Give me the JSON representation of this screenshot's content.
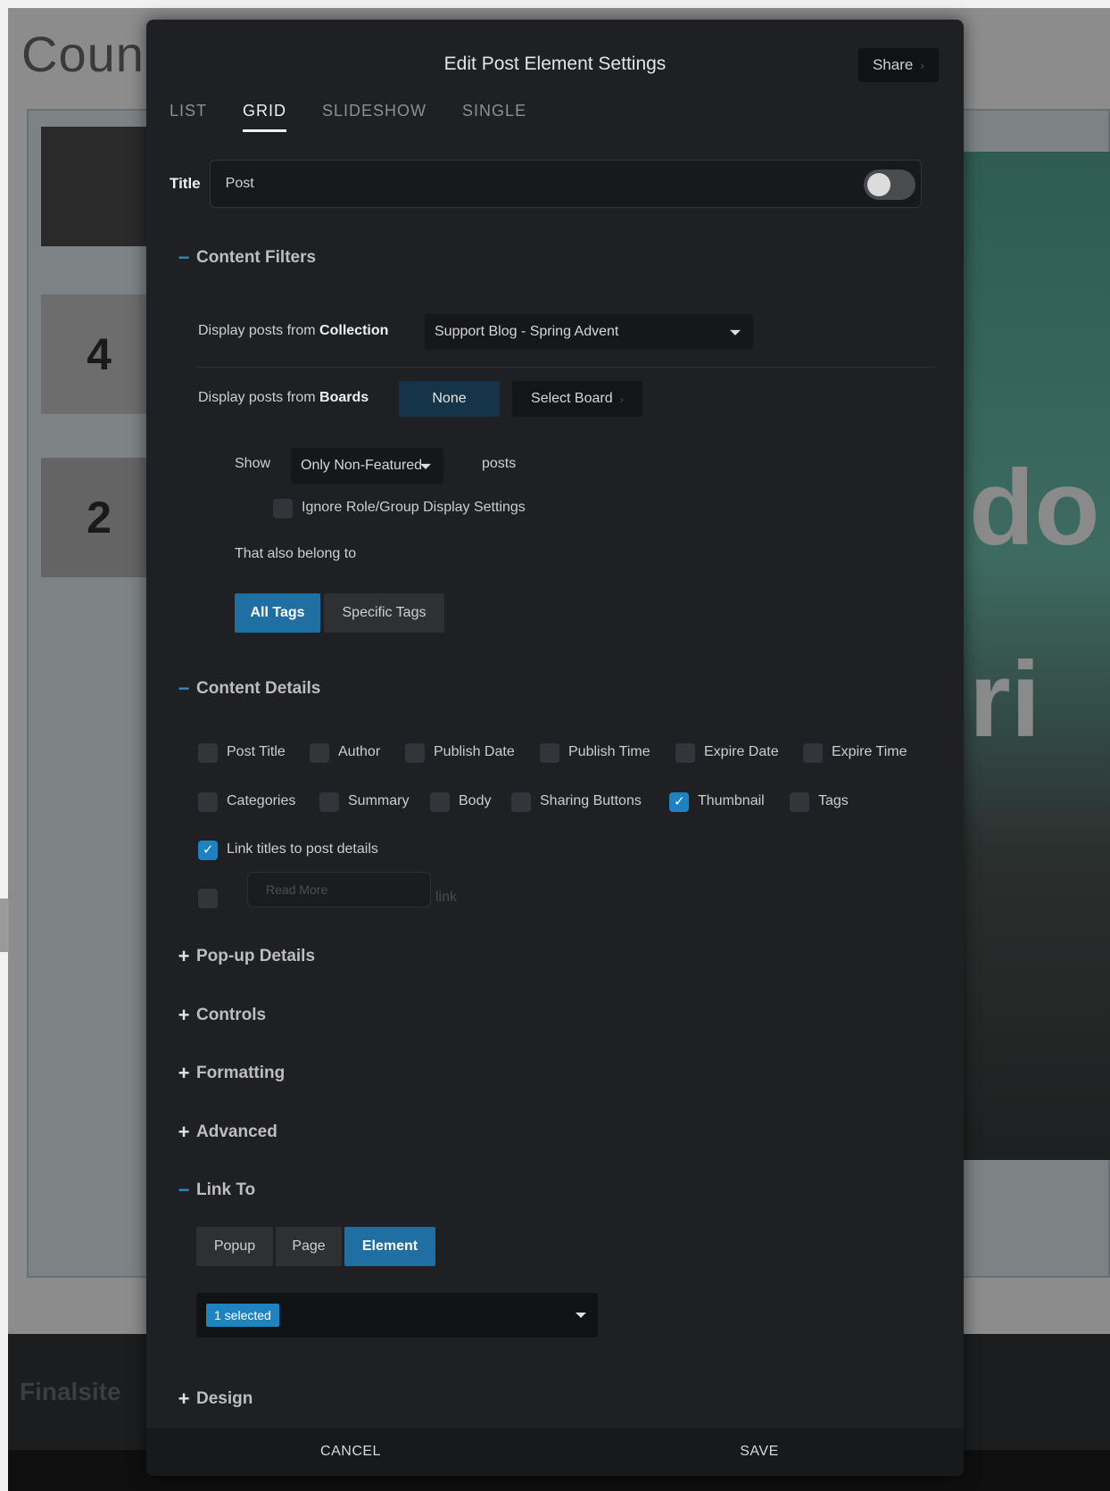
{
  "background": {
    "heading": "Coun",
    "thumb_numbers": [
      "",
      "4",
      "2"
    ],
    "hero_text": [
      "do",
      "ri"
    ],
    "footer_logo": "Finalsite"
  },
  "modal": {
    "title": "Edit Post Element Settings",
    "share_label": "Share",
    "tabs": [
      {
        "label": "LIST",
        "active": false
      },
      {
        "label": "GRID",
        "active": true
      },
      {
        "label": "SLIDESHOW",
        "active": false
      },
      {
        "label": "SINGLE",
        "active": false
      }
    ],
    "title_field": {
      "label": "Title",
      "value": "Post",
      "toggle_on": false
    },
    "content_filters": {
      "heading": "Content Filters",
      "collection_label_prefix": "Display posts from ",
      "collection_label_bold": "Collection",
      "collection_value": "Support Blog - Spring Advent",
      "boards_label_prefix": "Display posts from ",
      "boards_label_bold": "Boards",
      "boards_value": "None",
      "select_board_label": "Select Board",
      "show_label": "Show",
      "show_value": "Only Non-Featured",
      "posts_label": "posts",
      "ignore_role_label": "Ignore Role/Group Display Settings",
      "also_belong_label": "That also belong to",
      "tag_buttons": [
        {
          "label": "All Tags",
          "active": true
        },
        {
          "label": "Specific Tags",
          "active": false
        }
      ]
    },
    "content_details": {
      "heading": "Content Details",
      "row1": [
        {
          "label": "Post Title",
          "checked": false
        },
        {
          "label": "Author",
          "checked": false
        },
        {
          "label": "Publish Date",
          "checked": false
        },
        {
          "label": "Publish Time",
          "checked": false
        },
        {
          "label": "Expire Date",
          "checked": false
        },
        {
          "label": "Expire Time",
          "checked": false
        }
      ],
      "row2": [
        {
          "label": "Categories",
          "checked": false
        },
        {
          "label": "Summary",
          "checked": false
        },
        {
          "label": "Body",
          "checked": false
        },
        {
          "label": "Sharing Buttons",
          "checked": false
        },
        {
          "label": "Thumbnail",
          "checked": true
        },
        {
          "label": "Tags",
          "checked": false
        }
      ],
      "link_titles": {
        "label": "Link titles to post details",
        "checked": true
      },
      "read_more": {
        "placeholder": "Read More",
        "suffix": "link",
        "checked": false
      }
    },
    "sections": {
      "popup_details": "Pop-up Details",
      "controls": "Controls",
      "formatting": "Formatting",
      "advanced": "Advanced",
      "link_to": "Link To",
      "design": "Design"
    },
    "link_to": {
      "buttons": [
        {
          "label": "Popup",
          "active": false
        },
        {
          "label": "Page",
          "active": false
        },
        {
          "label": "Element",
          "active": true
        }
      ],
      "selected_pill": "1 selected"
    },
    "footer": {
      "cancel": "CANCEL",
      "save": "SAVE"
    }
  },
  "colors": {
    "accent": "#1f6fa3",
    "modal_bg": "#1f2023",
    "checkbox_checked": "#1d82c4"
  },
  "icons": {
    "share_chevron": "chevron-right-icon",
    "dropdown": "caret-down-icon",
    "check": "checkmark-icon"
  }
}
